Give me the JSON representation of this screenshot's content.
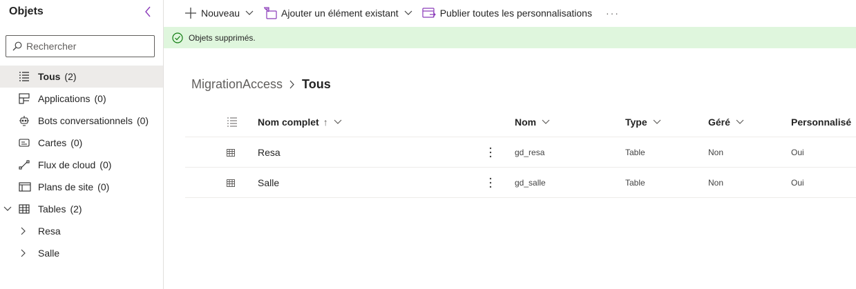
{
  "sidebar": {
    "title": "Objets",
    "search_placeholder": "Rechercher",
    "items": [
      {
        "label": "Tous",
        "count": "(2)"
      },
      {
        "label": "Applications",
        "count": "(0)"
      },
      {
        "label": "Bots conversationnels",
        "count": "(0)"
      },
      {
        "label": "Cartes",
        "count": "(0)"
      },
      {
        "label": "Flux de cloud",
        "count": "(0)"
      },
      {
        "label": "Plans de site",
        "count": "(0)"
      },
      {
        "label": "Tables",
        "count": "(2)"
      }
    ],
    "table_children": [
      {
        "label": "Resa"
      },
      {
        "label": "Salle"
      }
    ]
  },
  "toolbar": {
    "new_label": "Nouveau",
    "add_existing_label": "Ajouter un élément existant",
    "publish_label": "Publier toutes les personnalisations",
    "more_label": "···"
  },
  "message": {
    "text": "Objets supprimés."
  },
  "breadcrumb": {
    "parent": "MigrationAccess",
    "current": "Tous"
  },
  "table": {
    "columns": {
      "display_name": "Nom complet",
      "sort_indicator": "↑",
      "name": "Nom",
      "type": "Type",
      "managed": "Géré",
      "customized": "Personnalisé"
    },
    "rows": [
      {
        "display_name": "Resa",
        "name": "gd_resa",
        "type": "Table",
        "managed": "Non",
        "customized": "Oui"
      },
      {
        "display_name": "Salle",
        "name": "gd_salle",
        "type": "Table",
        "managed": "Non",
        "customized": "Oui"
      }
    ]
  },
  "colors": {
    "accent": "#8a3ab9",
    "success_bg": "#dff6dd",
    "selected_bg": "#edebe9"
  }
}
